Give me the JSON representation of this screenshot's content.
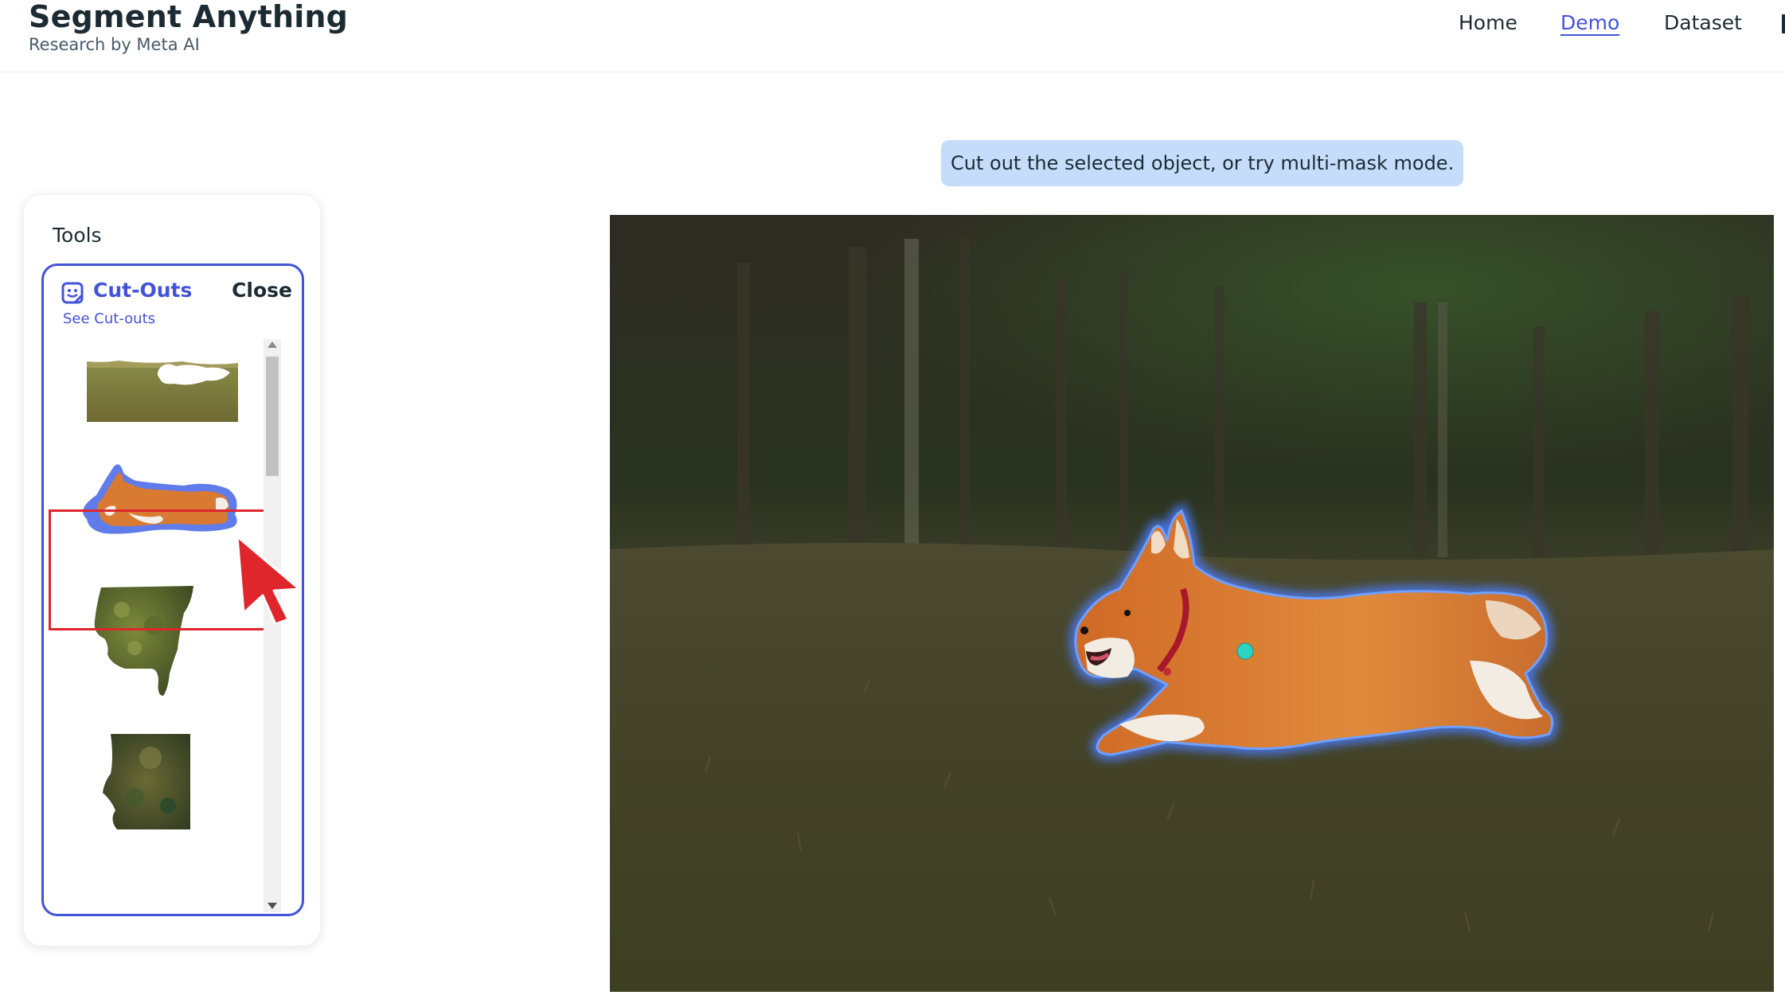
{
  "header": {
    "title": "Segment Anything",
    "subtitle": "Research by Meta AI",
    "nav": [
      {
        "label": "Home",
        "active": false
      },
      {
        "label": "Demo",
        "active": true
      },
      {
        "label": "Dataset",
        "active": false
      }
    ]
  },
  "tools": {
    "title": "Tools",
    "cutouts": {
      "label": "Cut-Outs",
      "icon": "sticker-icon",
      "close_label": "Close",
      "see_link": "See Cut-outs",
      "thumbnails": [
        {
          "name": "cutout-background-grass",
          "selected": false
        },
        {
          "name": "cutout-corgi",
          "selected": true
        },
        {
          "name": "cutout-tree-foliage",
          "selected": false
        },
        {
          "name": "cutout-bush",
          "selected": false
        }
      ]
    }
  },
  "main": {
    "hint": "Cut out the selected object, or try multi-mask mode.",
    "accent_color": "#4353d8",
    "selection_outline_color": "#e0262d",
    "click_point_color": "#2ed3c6"
  }
}
